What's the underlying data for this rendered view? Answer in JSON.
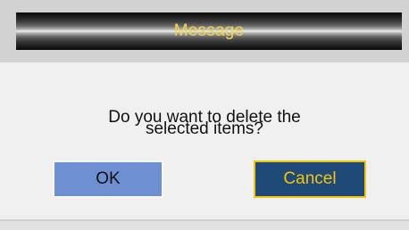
{
  "dialog": {
    "title": "Message",
    "message_line1": "Do you want to delete the",
    "message_line2": "selected items?",
    "ok_label": "OK",
    "cancel_label": "Cancel",
    "focused_button": "Cancel"
  },
  "colors": {
    "title_text": "#f4d44a",
    "ok_button_bg": "#6e8fd2",
    "cancel_button_bg": "#1f4a78",
    "focus_border": "#f1c40f",
    "dialog_bg": "#f0f0f0"
  }
}
